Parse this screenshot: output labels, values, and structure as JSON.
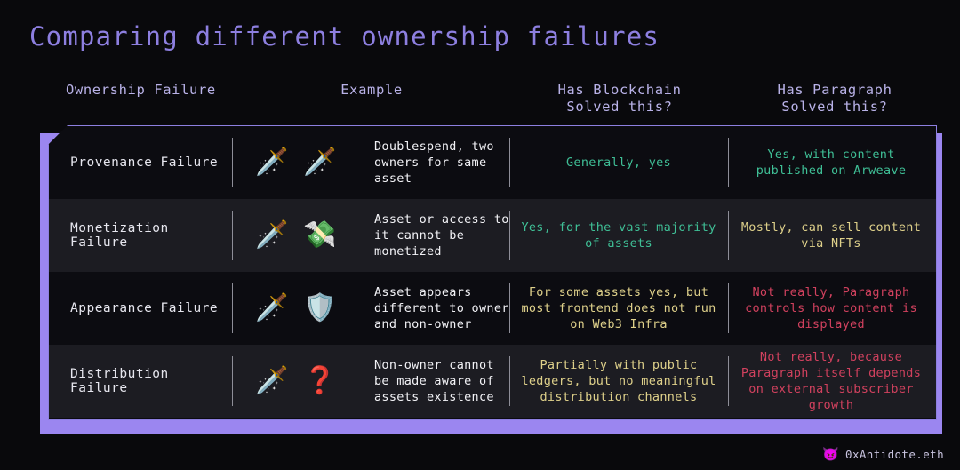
{
  "title": "Comparing different ownership failures",
  "colors": {
    "background": "#09090c",
    "title": "#8d7fe0",
    "accent_purple": "#8d7fe0",
    "shadow_purple": "#9b86f0",
    "header_text": "#b9b2e8",
    "row_odd_bg": "#0c0c11",
    "row_even_bg": "#1c1c22",
    "yes_green": "#3fbf96",
    "partial_yellow": "#ded08a",
    "no_red": "#d1415e",
    "body_text": "#f2f2f6",
    "divider": "#8e8e98"
  },
  "headers": [
    {
      "label": "Ownership Failure"
    },
    {
      "label": "Example"
    },
    {
      "label": "Has Blockchain\nSolved this?"
    },
    {
      "label": "Has Paragraph\nSolved this?"
    }
  ],
  "rows": [
    {
      "failure": "Provenance Failure",
      "emoji1": "🗡️",
      "emoji2": "🗡️",
      "emoji1_name": "dagger-icon",
      "emoji2_name": "dagger-icon",
      "example": "Doublespend, two\nowners for same\nasset",
      "blockchain": "Generally, yes",
      "blockchain_tone": "green",
      "paragraph": "Yes, with content\npublished on Arweave",
      "paragraph_tone": "green"
    },
    {
      "failure": "Monetization Failure",
      "emoji1": "🗡️",
      "emoji2": "💸",
      "emoji1_name": "dagger-icon",
      "emoji2_name": "money-crossed-out-icon",
      "example": "Asset or access to\nit cannot be\nmonetized",
      "blockchain": "Yes, for the vast majority\nof assets",
      "blockchain_tone": "green",
      "paragraph": "Mostly, can sell content\nvia NFTs",
      "paragraph_tone": "yellow"
    },
    {
      "failure": "Appearance Failure",
      "emoji1": "🗡️",
      "emoji2": "🛡️",
      "emoji1_name": "dagger-icon",
      "emoji2_name": "shield-icon",
      "example": "Asset appears\ndifferent to owner\nand non-owner",
      "blockchain": "For some assets yes, but\nmost frontend does not run\non Web3 Infra",
      "blockchain_tone": "yellow",
      "paragraph": "Not really, Paragraph\ncontrols how content is\ndisplayed",
      "paragraph_tone": "red"
    },
    {
      "failure": "Distribution Failure",
      "emoji1": "🗡️",
      "emoji2": "❓",
      "emoji1_name": "dagger-icon",
      "emoji2_name": "question-block-icon",
      "example": "Non-owner cannot\nbe made aware of\nassets existence",
      "blockchain": "Partially with public\nledgers, but no meaningful\ndistribution channels",
      "blockchain_tone": "yellow",
      "paragraph": "Not really, because\nParagraph itself depends\non external subscriber\ngrowth",
      "paragraph_tone": "red"
    }
  ],
  "footer": {
    "icon": "😈",
    "label": "0xAntidote.eth"
  }
}
